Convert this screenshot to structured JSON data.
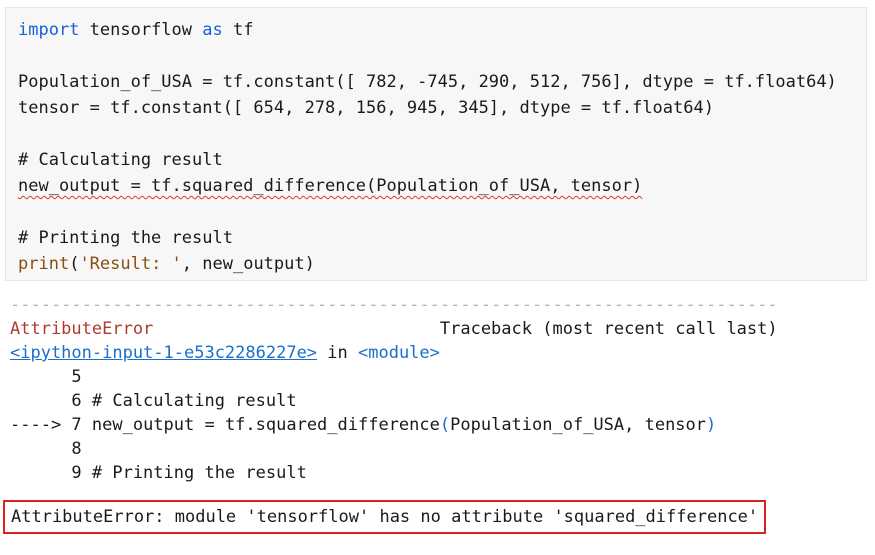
{
  "code_cell": {
    "lines": {
      "l1": {
        "import": "import",
        "module": " tensorflow ",
        "as": "as",
        "alias": " tf"
      },
      "l2": "",
      "l3": "Population_of_USA = tf.constant([ 782, -745, 290, 512, 756], dtype = tf.float64)",
      "l4": "tensor = tf.constant([ 654, 278, 156, 945, 345], dtype = tf.float64)",
      "l5": "",
      "l6": "# Calculating result",
      "l7": "new_output = tf.squared_difference(Population_of_USA, tensor)",
      "l8": "",
      "l9": "# Printing the result",
      "l10": {
        "fn": "print",
        "open": "(",
        "str": "'Result: '",
        "rest": ", new_output)"
      }
    }
  },
  "traceback": {
    "separator": "---------------------------------------------------------------------------",
    "error_type": "AttributeError",
    "traceback_label": "Traceback (most recent call last)",
    "source_link": "<ipython-input-1-e53c2286227e>",
    "in_text": " in ",
    "module_text": "<module>",
    "rows": {
      "r5": "      5",
      "r6": "      6 # Calculating result",
      "r7_arrow": "----> 7 ",
      "r7_code_a": "new_output = tf.squared_difference",
      "r7_open": "(",
      "r7_code_b": "Population_of_USA, tensor",
      "r7_close": ")",
      "r8": "      8",
      "r9": "      9 # Printing the result"
    },
    "final_error": "AttributeError: module 'tensorflow' has no attribute 'squared_difference'"
  },
  "colors": {
    "keyword": "#1a5fd8",
    "string": "#8a4c14",
    "link": "#1a6fcb",
    "error_border": "#e02020",
    "squiggle": "#d43a2f"
  }
}
